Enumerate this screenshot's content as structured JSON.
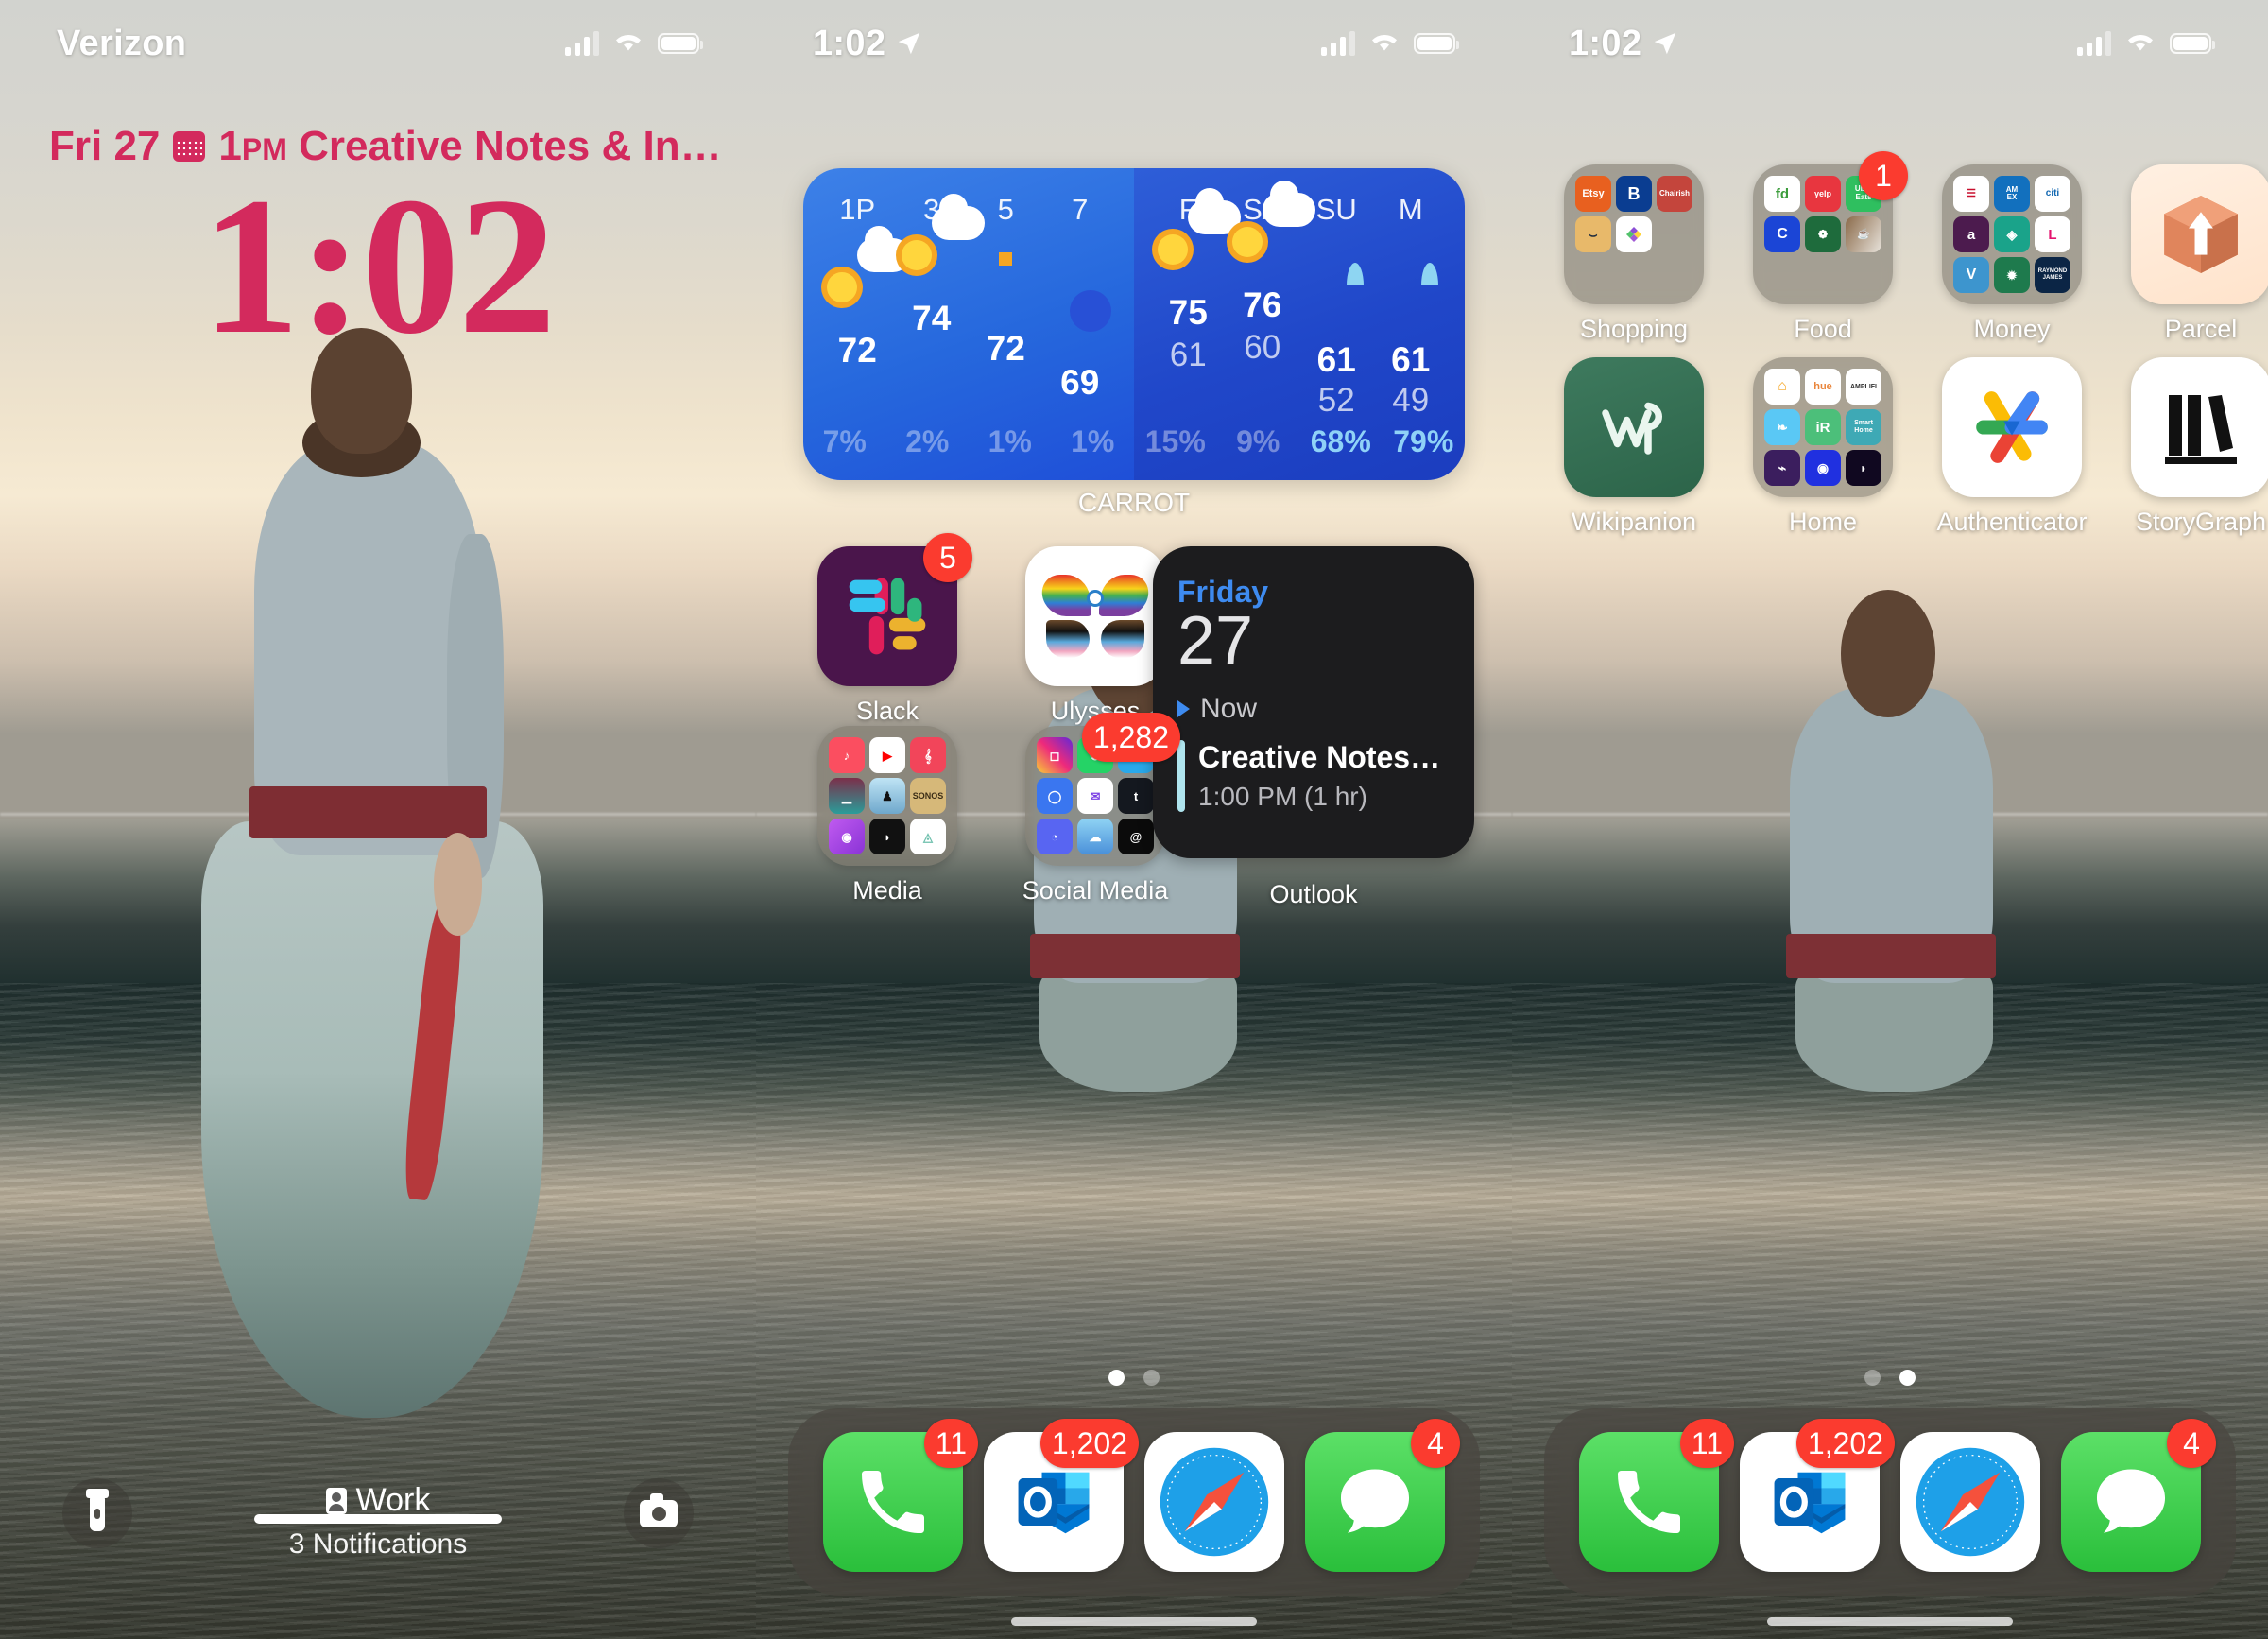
{
  "panels": [
    {
      "id": "lock-screen",
      "status": {
        "carrier": "Verizon",
        "signal_icon": "cellular-bars-icon",
        "wifi_icon": "wifi-icon",
        "battery_icon": "battery-icon"
      },
      "lock": {
        "event_date": "Fri 27",
        "calendar_icon": "calendar-icon",
        "event_time": "1",
        "event_time_suffix": "PM",
        "event_title": "Creative Notes & In…",
        "time": "1:02",
        "flashlight_icon": "flashlight-icon",
        "camera_icon": "camera-icon",
        "focus_icon": "focus-work-icon",
        "focus_label": "Work",
        "notifications": "3 Notifications"
      }
    },
    {
      "id": "home-screen-page-1",
      "status": {
        "time": "1:02",
        "location_icon": "location-arrow-icon",
        "signal_icon": "cellular-bars-icon",
        "wifi_icon": "wifi-icon",
        "battery_icon": "battery-icon"
      },
      "weather_widget": {
        "app_label": "CARROT",
        "hourly": [
          {
            "time": "1P",
            "icon": "partly-cloudy-icon",
            "temp": "72",
            "precip": "7%"
          },
          {
            "time": "3",
            "icon": "partly-cloudy-icon",
            "temp": "74",
            "precip": "2%"
          },
          {
            "time": "5",
            "icon": "sun-icon",
            "temp": "72",
            "precip": "1%"
          },
          {
            "time": "7",
            "icon": "moon-icon",
            "temp": "69",
            "precip": "1%"
          }
        ],
        "daily": [
          {
            "day": "F",
            "icon": "partly-cloudy-icon",
            "high": "75",
            "low": "61",
            "precip": "15%"
          },
          {
            "day": "SA",
            "icon": "partly-cloudy-icon",
            "high": "76",
            "low": "60",
            "precip": "9%"
          },
          {
            "day": "SU",
            "icon": "rain-drop-icon",
            "high": "61",
            "low": "52",
            "precip": "68%"
          },
          {
            "day": "M",
            "icon": "rain-drop-icon",
            "high": "61",
            "low": "49",
            "precip": "79%"
          }
        ]
      },
      "apps": [
        {
          "name": "Slack",
          "icon": "slack-icon",
          "badge": "5"
        },
        {
          "name": "Ulysses",
          "icon": "ulysses-icon",
          "badge": ""
        },
        {
          "name": "Media",
          "icon": "folder-icon",
          "badge": ""
        },
        {
          "name": "Social Media",
          "icon": "folder-icon",
          "badge": "1,282"
        }
      ],
      "outlook_widget": {
        "name": "Outlook",
        "weekday": "Friday",
        "date": "27",
        "section": "Now",
        "event_title": "Creative Notes…",
        "event_time": "1:00 PM (1 hr)"
      },
      "page_dots": {
        "count": 2,
        "active": 0
      },
      "dock": [
        {
          "name": "Phone",
          "icon": "phone-icon",
          "badge": "11"
        },
        {
          "name": "Outlook",
          "icon": "outlook-icon",
          "badge": "1,202"
        },
        {
          "name": "Safari",
          "icon": "safari-icon",
          "badge": ""
        },
        {
          "name": "Messages",
          "icon": "messages-icon",
          "badge": "4"
        }
      ]
    },
    {
      "id": "home-screen-page-2",
      "status": {
        "time": "1:02",
        "location_icon": "location-arrow-icon",
        "signal_icon": "cellular-bars-icon",
        "wifi_icon": "wifi-icon",
        "battery_icon": "battery-icon"
      },
      "apps": [
        {
          "name": "Shopping",
          "icon": "folder-icon",
          "badge": ""
        },
        {
          "name": "Food",
          "icon": "folder-icon",
          "badge": "1"
        },
        {
          "name": "Money",
          "icon": "folder-icon",
          "badge": ""
        },
        {
          "name": "Parcel",
          "icon": "parcel-icon",
          "badge": ""
        },
        {
          "name": "Wikipanion",
          "icon": "wikipanion-icon",
          "badge": ""
        },
        {
          "name": "Home",
          "icon": "folder-icon",
          "badge": ""
        },
        {
          "name": "Authenticator",
          "icon": "authenticator-icon",
          "badge": ""
        },
        {
          "name": "StoryGraph",
          "icon": "storygraph-icon",
          "badge": ""
        }
      ],
      "page_dots": {
        "count": 2,
        "active": 1
      },
      "dock": [
        {
          "name": "Phone",
          "icon": "phone-icon",
          "badge": "11"
        },
        {
          "name": "Outlook",
          "icon": "outlook-icon",
          "badge": "1,202"
        },
        {
          "name": "Safari",
          "icon": "safari-icon",
          "badge": ""
        },
        {
          "name": "Messages",
          "icon": "messages-icon",
          "badge": "4"
        }
      ]
    }
  ],
  "colors": {
    "lock_accent": "#D32A5D",
    "badge_red": "#FB3B2F",
    "weather_left": "#2668DD",
    "weather_right": "#2047C9",
    "outlook_blue": "#3E8BF0",
    "widget_dark": "#1C1C1E"
  }
}
